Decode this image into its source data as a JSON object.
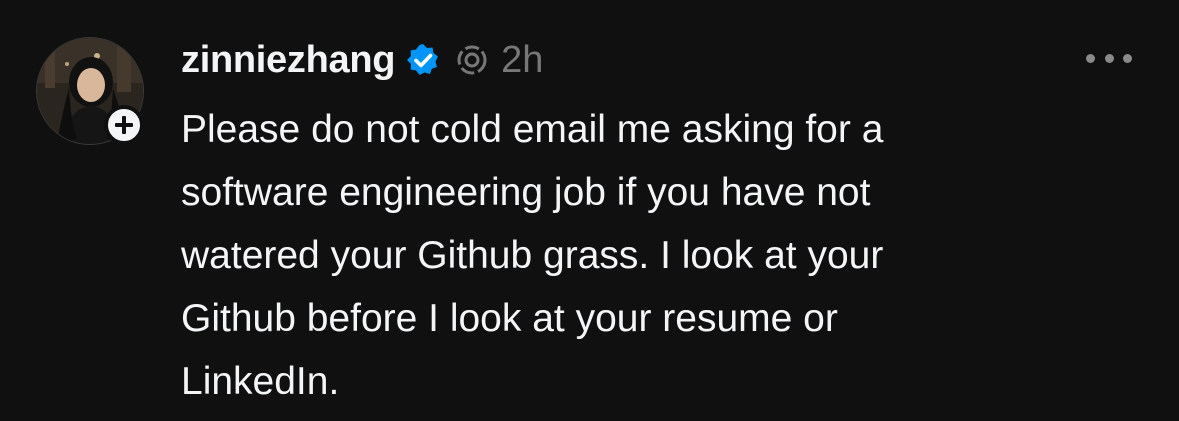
{
  "post": {
    "author": {
      "username": "zinniezhang",
      "verified": true,
      "avatar_icon": "profile-photo",
      "follow_icon": "plus-icon"
    },
    "timestamp": "2h",
    "repost_icon": "threads-ring-icon",
    "more_icon": "ellipsis-icon",
    "text": "Please do not cold email me asking for a\nsoftware engineering job if you have not\nwatered your Github grass. I look at your\nGithub before I look at your resume or\nLinkedIn."
  },
  "colors": {
    "background": "#101010",
    "text_primary": "#f3f5f7",
    "text_secondary": "#777777",
    "verified_blue": "#0095f6"
  }
}
